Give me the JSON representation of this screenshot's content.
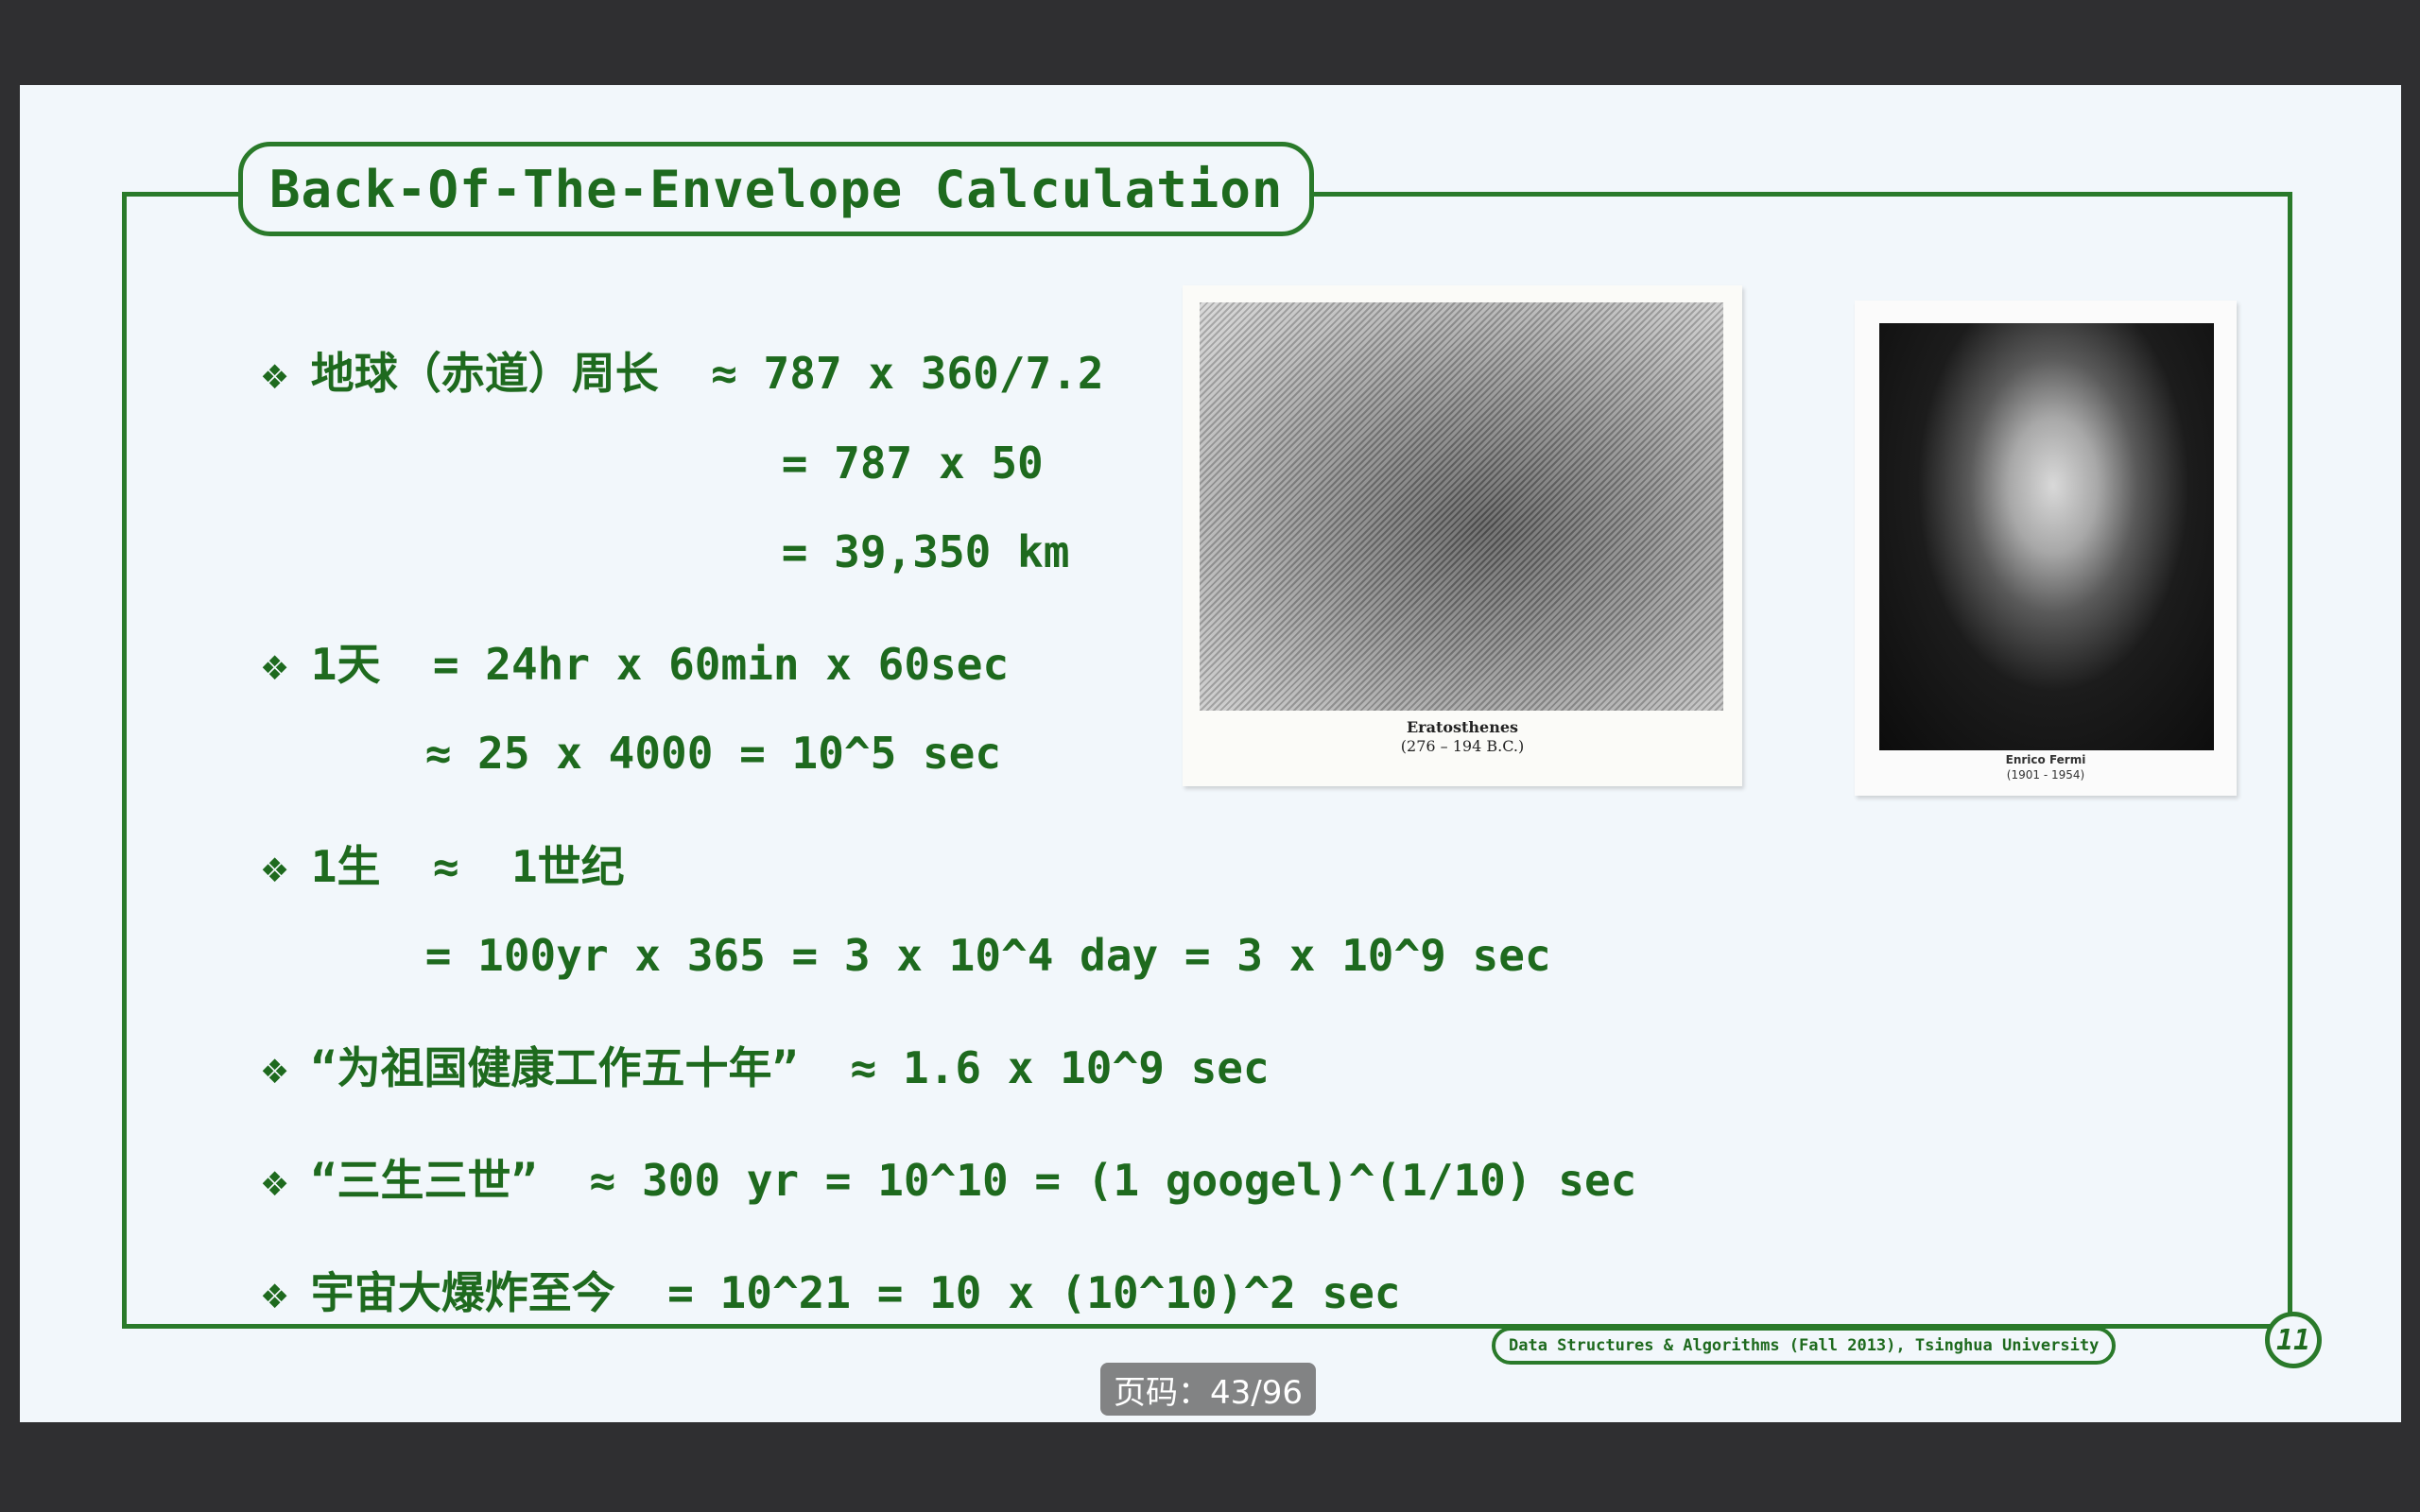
{
  "slide": {
    "title": "Back-Of-The-Envelope Calculation",
    "bullet_glyph": "❖",
    "lines": [
      {
        "bullet": true,
        "text": "地球（赤道）周长  ≈ 787 x 360/7.2"
      },
      {
        "bullet": false,
        "text": "= 787 x 50"
      },
      {
        "bullet": false,
        "text": "= 39,350 km"
      },
      {
        "bullet": true,
        "text": "1天  = 24hr x 60min x 60sec"
      },
      {
        "bullet": false,
        "text": "≈ 25 x 4000 = 10^5 sec"
      },
      {
        "bullet": true,
        "text": "1生  ≈  1世纪"
      },
      {
        "bullet": false,
        "text": "= 100yr x 365 = 3 x 10^4 day = 3 x 10^9 sec"
      },
      {
        "bullet": true,
        "text": "“为祖国健康工作五十年”  ≈ 1.6 x 10^9 sec"
      },
      {
        "bullet": true,
        "text": "“三生三世”  ≈ 300 yr = 10^10 = (1 googel)^(1/10) sec"
      },
      {
        "bullet": true,
        "text": "宇宙大爆炸至今  = 10^21 = 10 x (10^10)^2 sec"
      }
    ],
    "photo1": {
      "name": "Eratosthenes",
      "dates": "(276 – 194 B.C.)"
    },
    "photo2": {
      "name": "Enrico Fermi",
      "dates": "(1901 - 1954)"
    },
    "footer": "Data Structures & Algorithms (Fall 2013), Tsinghua University",
    "page_number": "11"
  },
  "viewer": {
    "page_indicator": "页码：43/96"
  },
  "colors": {
    "accent_green": "#2a7a2a",
    "slide_background": "#f2f7fb",
    "app_background": "#2f2f31"
  }
}
